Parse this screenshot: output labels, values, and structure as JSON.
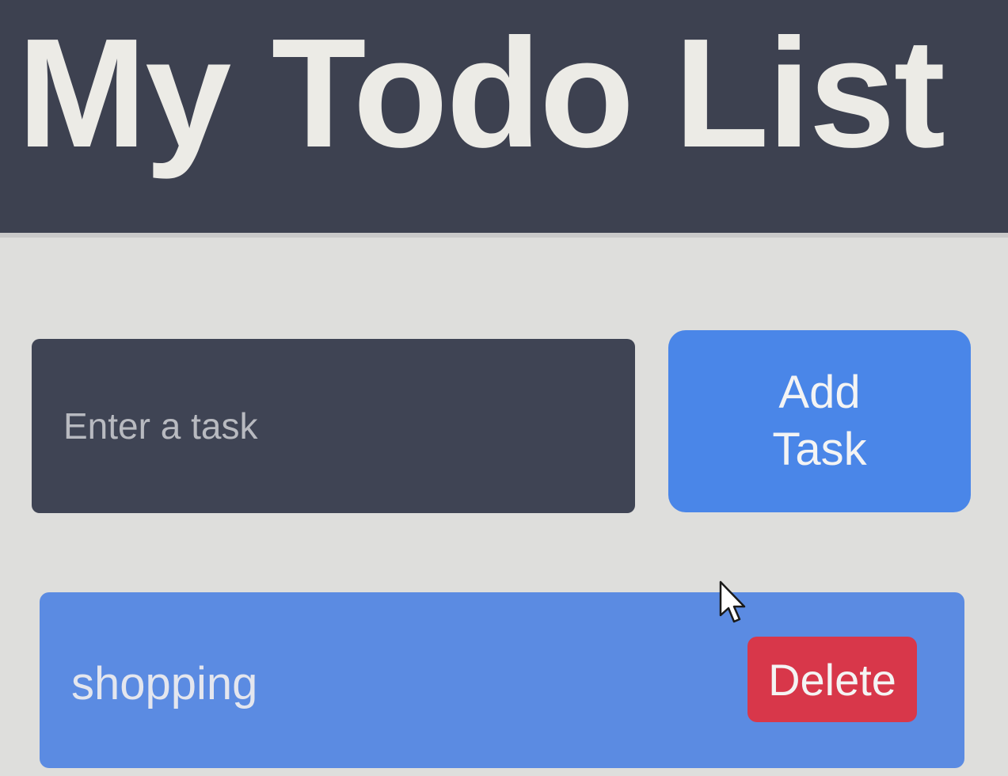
{
  "header": {
    "title": "My Todo List"
  },
  "input": {
    "placeholder": "Enter a task",
    "value": ""
  },
  "add_button": {
    "label": "Add Task"
  },
  "tasks": [
    {
      "text": "shopping",
      "delete_label": "Delete"
    }
  ],
  "colors": {
    "header_bg": "#3d4150",
    "page_bg": "#dededc",
    "input_bg": "#3f4454",
    "accent": "#4a86e8",
    "task_bg": "#5b8be2",
    "delete": "#d8374a",
    "text_light": "#ecebe6"
  },
  "icons": {
    "cursor": "mouse-pointer-icon"
  }
}
